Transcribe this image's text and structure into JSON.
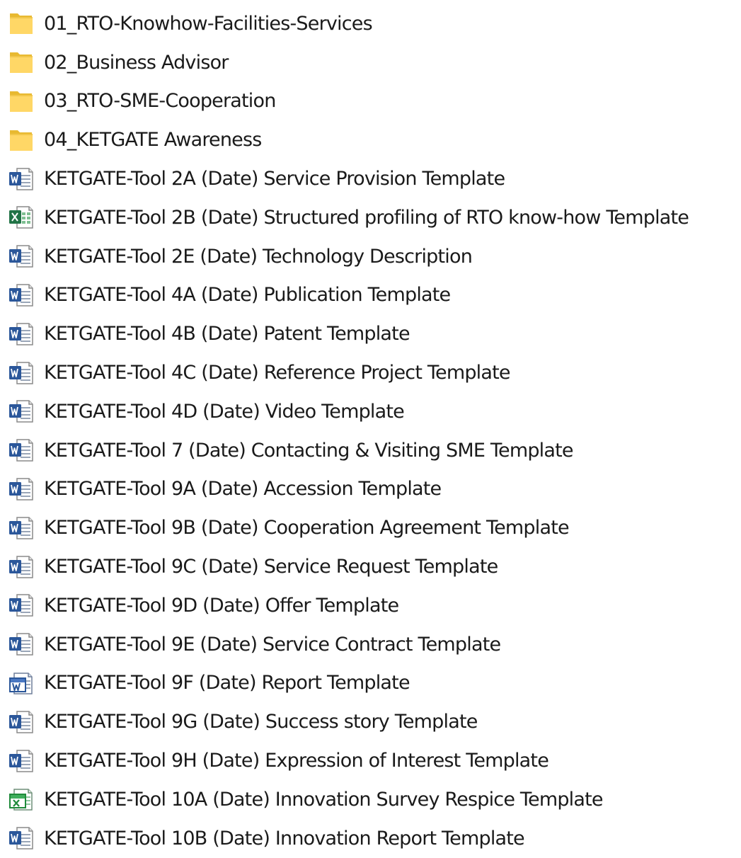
{
  "items": [
    {
      "name": "01_RTO-Knowhow-Facilities-Services",
      "type": "folder",
      "icon": "folder-icon"
    },
    {
      "name": "02_Business Advisor",
      "type": "folder",
      "icon": "folder-icon"
    },
    {
      "name": "03_RTO-SME-Cooperation",
      "type": "folder",
      "icon": "folder-icon"
    },
    {
      "name": "04_KETGATE Awareness",
      "type": "folder",
      "icon": "folder-icon"
    },
    {
      "name": "KETGATE-Tool 2A (Date) Service Provision Template",
      "type": "word",
      "icon": "word-document-icon"
    },
    {
      "name": "KETGATE-Tool 2B (Date) Structured profiling of RTO know-how Template",
      "type": "excel",
      "icon": "excel-document-icon"
    },
    {
      "name": "KETGATE-Tool 2E (Date) Technology Description",
      "type": "word",
      "icon": "word-document-icon"
    },
    {
      "name": "KETGATE-Tool 4A (Date) Publication Template",
      "type": "word",
      "icon": "word-document-icon"
    },
    {
      "name": "KETGATE-Tool 4B (Date) Patent Template",
      "type": "word",
      "icon": "word-document-icon"
    },
    {
      "name": "KETGATE-Tool 4C (Date) Reference Project Template",
      "type": "word",
      "icon": "word-document-icon"
    },
    {
      "name": "KETGATE-Tool 4D (Date) Video Template",
      "type": "word",
      "icon": "word-document-icon"
    },
    {
      "name": "KETGATE-Tool 7 (Date) Contacting & Visiting SME Template",
      "type": "word",
      "icon": "word-document-icon"
    },
    {
      "name": "KETGATE-Tool 9A (Date) Accession Template",
      "type": "word",
      "icon": "word-document-icon"
    },
    {
      "name": "KETGATE-Tool 9B (Date) Cooperation Agreement Template",
      "type": "word",
      "icon": "word-document-icon"
    },
    {
      "name": "KETGATE-Tool 9C (Date) Service Request Template",
      "type": "word",
      "icon": "word-document-icon"
    },
    {
      "name": "KETGATE-Tool 9D (Date) Offer Template",
      "type": "word",
      "icon": "word-document-icon"
    },
    {
      "name": "KETGATE-Tool 9E (Date) Service Contract Template",
      "type": "word",
      "icon": "word-document-icon"
    },
    {
      "name": "KETGATE-Tool 9F (Date) Report Template",
      "type": "word-legacy",
      "icon": "word-legacy-document-icon"
    },
    {
      "name": "KETGATE-Tool 9G (Date) Success story Template",
      "type": "word",
      "icon": "word-document-icon"
    },
    {
      "name": "KETGATE-Tool 9H (Date) Expression of Interest Template",
      "type": "word",
      "icon": "word-document-icon"
    },
    {
      "name": "KETGATE-Tool 10A (Date) Innovation Survey Respice Template",
      "type": "excel-legacy",
      "icon": "excel-legacy-document-icon"
    },
    {
      "name": "KETGATE-Tool 10B (Date) Innovation Report Template",
      "type": "word",
      "icon": "word-document-icon"
    }
  ],
  "colors": {
    "folder_back": "#e8b931",
    "folder_front": "#ffd766",
    "word": "#2b579a",
    "excel": "#217346",
    "excel_legacy": "#1f8a3a",
    "text": "#1a1a1a"
  }
}
